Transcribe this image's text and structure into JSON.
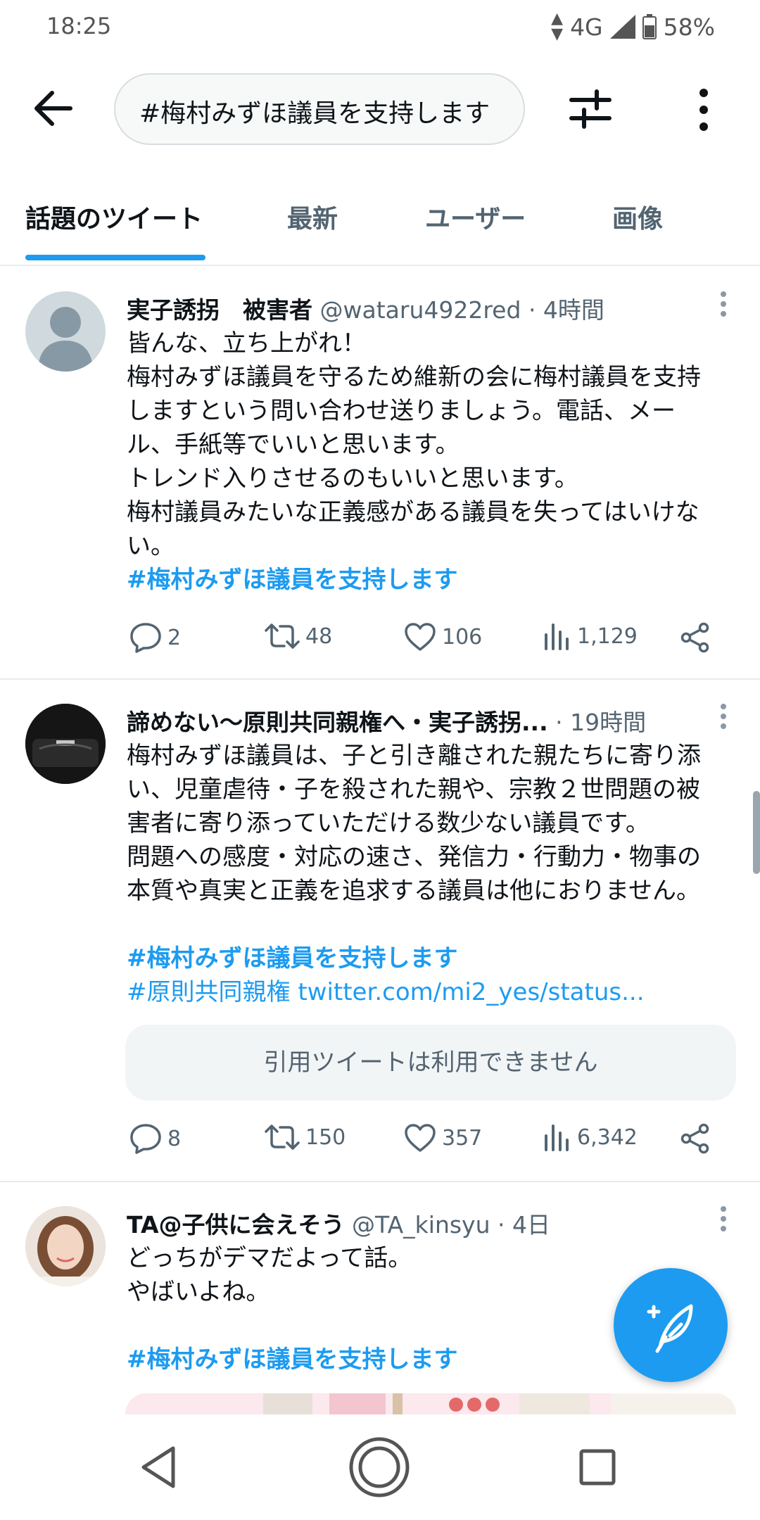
{
  "status_bar": {
    "time": "18:25",
    "network": "4G",
    "battery": "58%"
  },
  "search": {
    "query": "#梅村みずほ議員を支持します"
  },
  "tabs": [
    {
      "label": "話題のツイート",
      "active": true
    },
    {
      "label": "最新",
      "active": false
    },
    {
      "label": "ユーザー",
      "active": false
    },
    {
      "label": "画像",
      "active": false
    }
  ],
  "tweets": [
    {
      "display_name": "実子誘拐　被害者",
      "handle": "@wataru4922red",
      "time": "· 4時間",
      "lines": [
        "皆んな、立ち上がれ！",
        "梅村みずほ議員を守るため維新の会に梅村議員を支持",
        "しますという問い合わせ送りましょう。電話、メー",
        "ル、手紙等でいいと思います。",
        "トレンド入りさせるのもいいと思います。",
        "梅村議員みたいな正義感がある議員を失ってはいけな",
        "い。"
      ],
      "hashtag": "#梅村みずほ議員を支持します",
      "replies": "2",
      "retweets": "48",
      "likes": "106",
      "views": "1,129"
    },
    {
      "display_name": "諦めない〜原則共同親権へ・実子誘拐...",
      "handle": "",
      "time": "· 19時間",
      "lines": [
        "梅村みずほ議員は、子と引き離された親たちに寄り添",
        "い、児童虐待・子を殺された親や、宗教２世問題の被",
        "害者に寄り添っていただける数少ない議員です。",
        "問題への感度・対応の速さ、発信力・行動力・物事の",
        "本質や真実と正義を追求する議員は他におりません。"
      ],
      "hashtag": "#梅村みずほ議員を支持します",
      "hashtag2": "#原則共同親権",
      "link": "twitter.com/mi2_yes/status...",
      "quote": "引用ツイートは利用できません",
      "replies": "8",
      "retweets": "150",
      "likes": "357",
      "views": "6,342"
    },
    {
      "display_name": "TA@子供に会えそう",
      "handle": "@TA_kinsyu",
      "time": "· 4日",
      "lines": [
        "どっちがデマだよって話。",
        "やばいよね。"
      ],
      "hashtag": "#梅村みずほ議員を支持します"
    }
  ],
  "colors": {
    "accent": "#1d9bf0",
    "text": "#0f1419",
    "secondary": "#536471"
  }
}
